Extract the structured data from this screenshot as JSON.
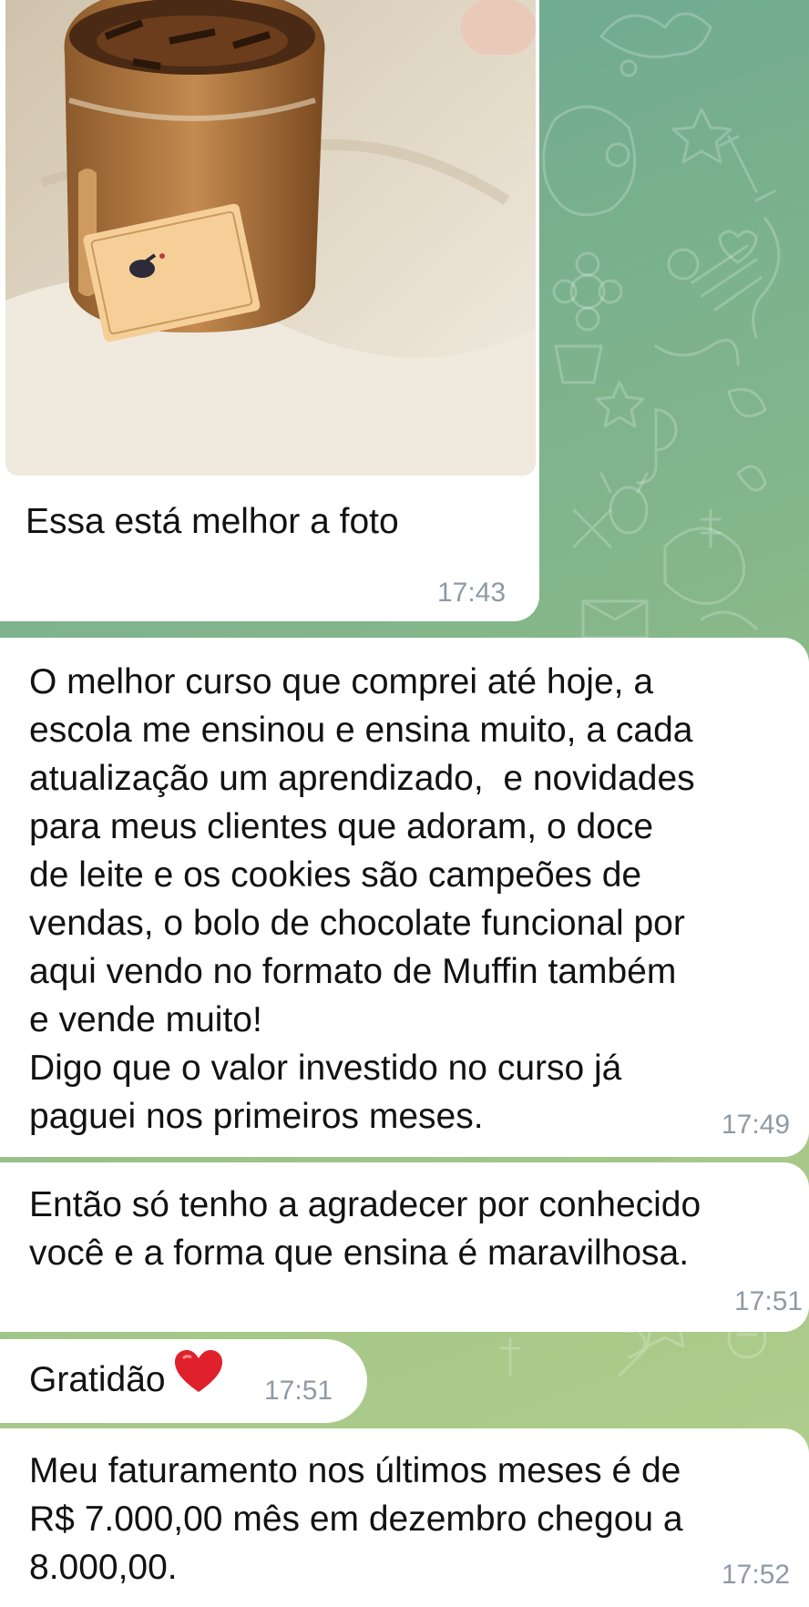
{
  "colors": {
    "wallpaper_start": "#6aa892",
    "wallpaper_end": "#b3cf8c",
    "bubble": "#ffffff",
    "message_text": "#121212",
    "timestamp": "#8f9aa5",
    "heart": "#e0212c"
  },
  "messages": [
    {
      "type": "photo",
      "caption": "Essa está melhor a foto",
      "time": "17:43",
      "photo_icon": "jar-dessert-photo"
    },
    {
      "type": "text",
      "text": "O melhor curso que comprei até hoje, a\nescola me ensinou e ensina muito, a cada\natualização um aprendizado,  e novidades\npara meus clientes que adoram, o doce\nde leite e os cookies são campeões de\nvendas, o bolo de chocolate funcional por\naqui vendo no formato de Muffin também\ne vende muito!\nDigo que o valor investido no curso já\npaguei nos primeiros meses.",
      "time": "17:49"
    },
    {
      "type": "text",
      "text": "Então só tenho a agradecer por conhecido\nvocê e a forma que ensina é maravilhosa.",
      "time": "17:51"
    },
    {
      "type": "text",
      "text": "Gratidão",
      "emoji": "red-heart",
      "time": "17:51"
    },
    {
      "type": "text",
      "text": "Meu faturamento nos últimos meses é de\nR$ 7.000,00 mês em dezembro chegou a\n8.000,00.",
      "time": "17:52"
    }
  ]
}
